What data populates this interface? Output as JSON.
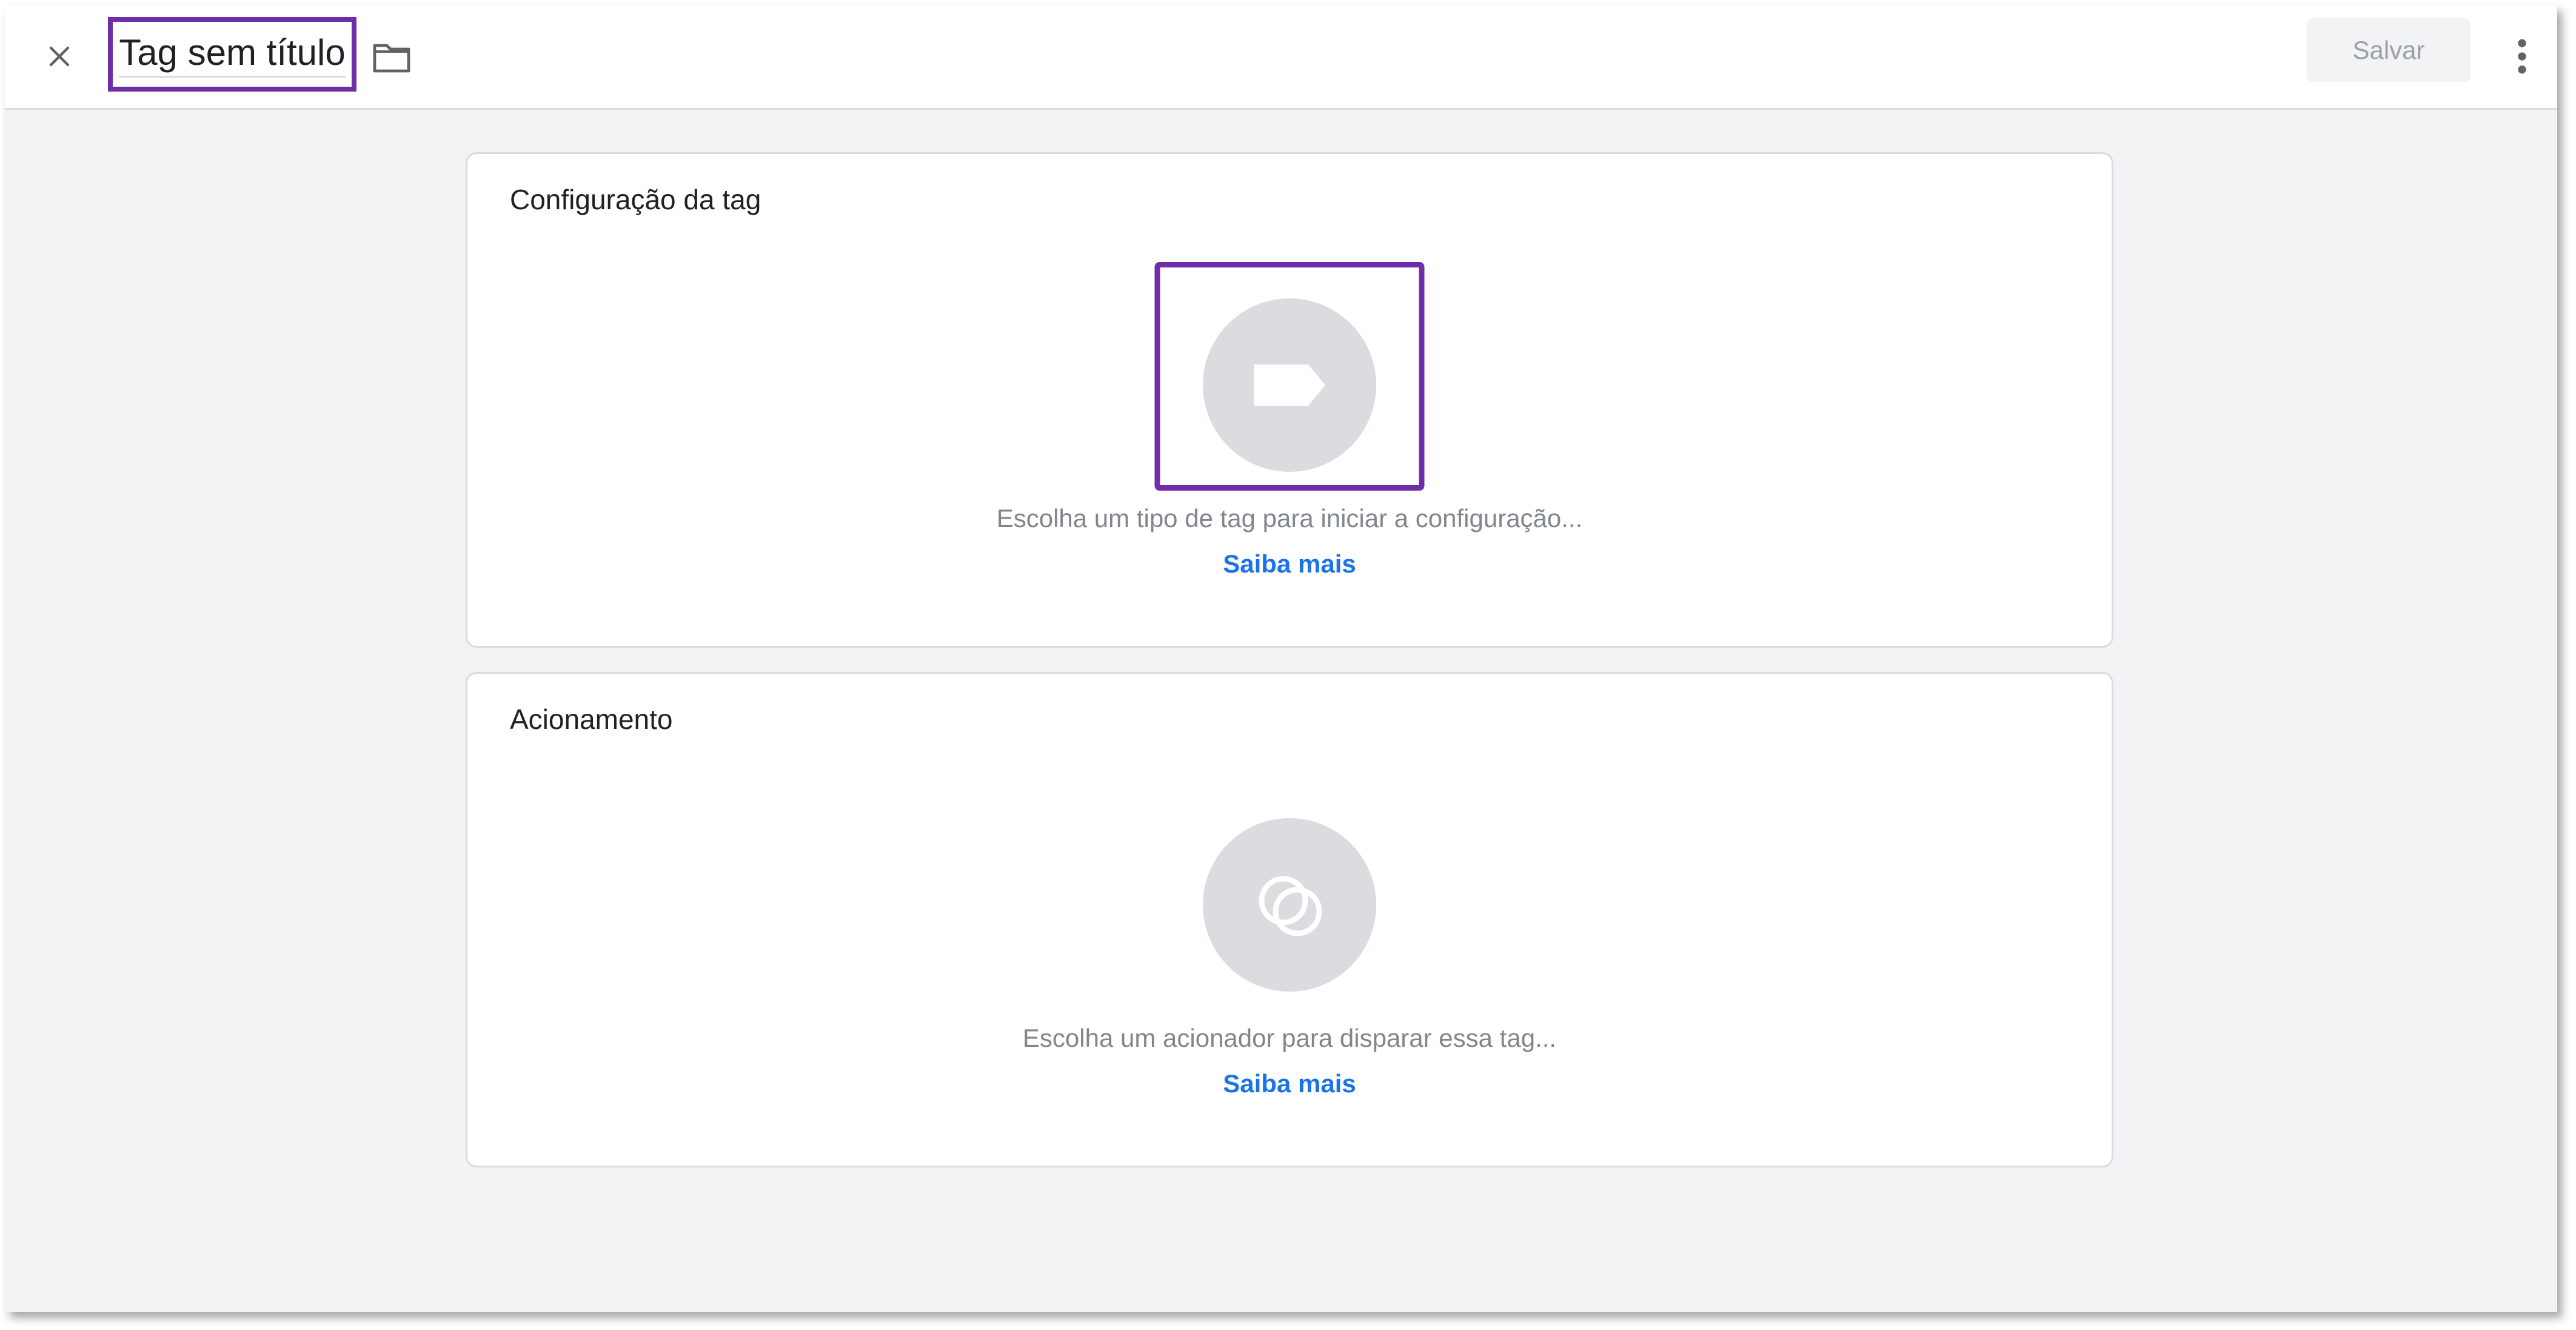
{
  "header": {
    "title": "Tag sem título",
    "save_label": "Salvar",
    "close_icon": "close-icon",
    "folder_icon": "folder-icon",
    "more_icon": "more-vert-icon"
  },
  "tag_config": {
    "title": "Configuração da tag",
    "hint": "Escolha um tipo de tag para iniciar a configuração...",
    "learn_more": "Saiba mais",
    "icon": "tag-icon"
  },
  "trigger": {
    "title": "Acionamento",
    "hint": "Escolha um acionador para disparar essa tag...",
    "learn_more": "Saiba mais",
    "icon": "trigger-icon"
  },
  "colors": {
    "accent": "#1a73e8",
    "highlight": "#6f2da8",
    "background": "#f1f3f4",
    "icon_circle": "#dadce0"
  }
}
